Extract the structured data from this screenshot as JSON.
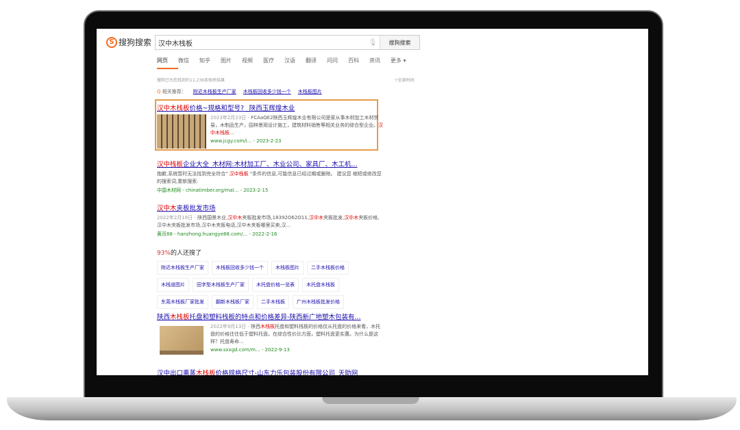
{
  "header": {
    "logo": "搜狗搜索",
    "query": "汉中木栈板",
    "search_button": "搜狗搜索"
  },
  "tabs": [
    "网页",
    "微信",
    "知乎",
    "图片",
    "视频",
    "医疗",
    "汉语",
    "翻译",
    "问问",
    "百科",
    "资讯",
    "更多 ▾"
  ],
  "result_count": "搜狗已为您找到约11,236条相关结果",
  "time_filter": "▽全部时间",
  "related": {
    "label": "相关推荐：",
    "items": [
      "附近木栈板生产厂家",
      "木栈板回收多少钱一个",
      "木栈板图片"
    ]
  },
  "results": [
    {
      "title": [
        {
          "t": "汉中木栈板",
          "hl": true
        },
        {
          "t": "价格~规格和型号? _陕西玉辉煌木业"
        }
      ],
      "date": "2023年2月23日 - ",
      "desc": [
        {
          "t": "FCAaQE2陕西玉辉煌木业有限公司是家从事木材加工木材贸易，木制品生产，园林景观设计施工，建筑材料销售等相关业务的综合型企业。"
        },
        {
          "t": "汉中木栈板",
          "hl": true
        },
        {
          "t": "..."
        }
      ],
      "url": "www.jcgy.com/i... - 2023-2-23"
    },
    {
      "title": [
        {
          "t": "汉中栈板",
          "hl": true
        },
        {
          "t": "企业大全_木材网:木材加工厂、木业公司、家具厂、木工机..."
        }
      ],
      "date": "",
      "desc": [
        {
          "t": "抱歉,系统暂时无法找到完全符合\" "
        },
        {
          "t": "汉中栈板",
          "hl": true
        },
        {
          "t": " \"条件的信息,可能信息已经过期或删除。 建议您 缩短或修改您的搜索词,重新搜索."
        }
      ],
      "url": "中国木材网 - chinatimber.org/mal... - 2023-2-15"
    },
    {
      "title": [
        {
          "t": "汉中木",
          "hl": true
        },
        {
          "t": "夹板批发市场"
        }
      ],
      "date": "2022年2月16日 - ",
      "desc": [
        {
          "t": "陕西国景木业,"
        },
        {
          "t": "汉中木",
          "hl": true
        },
        {
          "t": "夹板批发市场,18392O62O11,"
        },
        {
          "t": "汉中木",
          "hl": true
        },
        {
          "t": "夹板批发,"
        },
        {
          "t": "汉中木",
          "hl": true
        },
        {
          "t": "夹板价格,汉中木夹板批发市场,汉中木夹板电话,汉中木夹板哪里买卖,汉..."
        }
      ],
      "url": "黄页88 - hanzhong.huangye88.com/... - 2022-2-16"
    },
    {
      "title": [
        {
          "t": "陕西"
        },
        {
          "t": "木栈板",
          "hl": true
        },
        {
          "t": "托盘和塑料栈板的特点和价格差异-陕西新广地塑木包装有..."
        }
      ],
      "date": "2022年9月13日 - ",
      "desc": [
        {
          "t": "陕西"
        },
        {
          "t": "木栈板",
          "hl": true
        },
        {
          "t": "托盘和塑料栈板的价格仅从托盘的价格来看，木托盘的价格往往低于塑料托盘。在综合性价比方面，塑料托盘更实惠。为什么是这样？托盘寿命..."
        }
      ],
      "url": "www.sxxgd.com/m... - 2022-9-13"
    },
    {
      "title": [
        {
          "t": "汉中出口熏蒸"
        },
        {
          "t": "木栈板",
          "hl": true
        },
        {
          "t": "价格规格尺寸-山东力乐包装股份有限公司_天助网"
        }
      ]
    }
  ],
  "also_searched": {
    "pct": "93%",
    "label": "的人还搜了",
    "items": [
      "附近木栈板生产厂家",
      "木栈板回收多少钱一个",
      "木栈板图片",
      "二手木栈板价格",
      "木栈道图片",
      "田字型木栈板生产厂家",
      "木托盘价格一览表",
      "木托盘木栈板",
      "东莞木栈板厂家批发",
      "翻新木栈板厂家",
      "二手木栈板",
      "广州木栈板批发价格"
    ]
  },
  "colors": {
    "accent": "#f26b1d",
    "highlight_box": "#e49b4c",
    "link": "#1a0dab",
    "keyword": "#dd0000",
    "url": "#1f8a1f"
  }
}
